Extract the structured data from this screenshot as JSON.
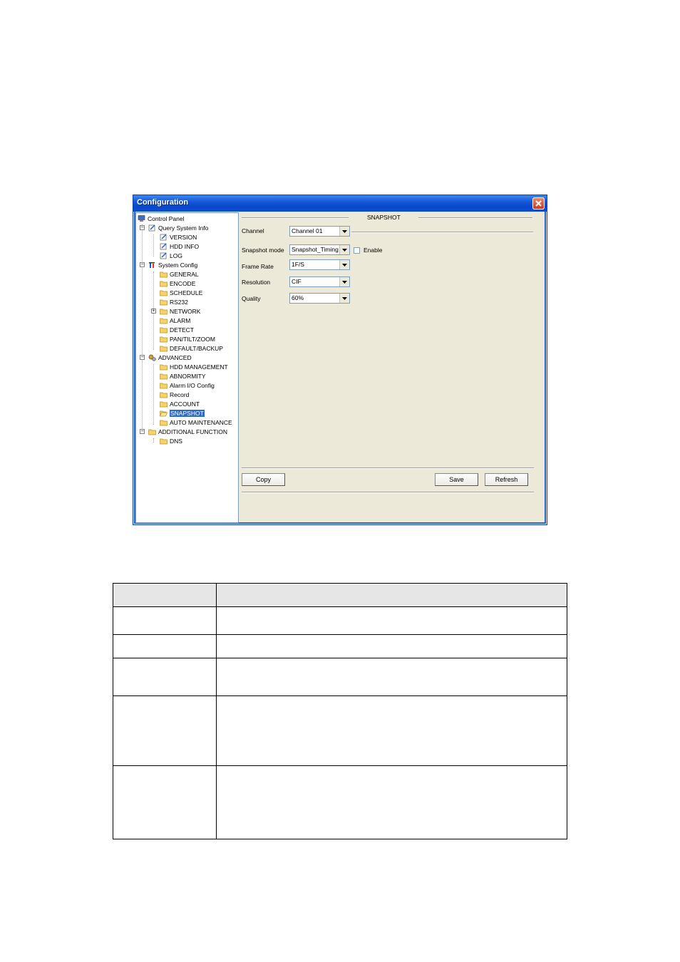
{
  "window": {
    "title": "Configuration"
  },
  "tree": {
    "root": "Control Panel",
    "items": [
      "Query System Info",
      "VERSION",
      "HDD INFO",
      "LOG",
      "System Config",
      "GENERAL",
      "ENCODE",
      "SCHEDULE",
      "RS232",
      "NETWORK",
      "ALARM",
      "DETECT",
      "PAN/TILT/ZOOM",
      "DEFAULT/BACKUP",
      "ADVANCED",
      "HDD MANAGEMENT",
      "ABNORMITY",
      "Alarm I/O Config",
      "Record",
      "ACCOUNT",
      "SNAPSHOT",
      "AUTO MAINTENANCE",
      "ADDITIONAL FUNCTION",
      "DNS"
    ],
    "selected": "SNAPSHOT"
  },
  "panel": {
    "section_title": "SNAPSHOT",
    "channel_label": "Channel",
    "channel_value": "Channel 01",
    "mode_label": "Snapshot mode",
    "mode_value": "Snapshot_Timing",
    "enable_label": "Enable",
    "framerate_label": "Frame Rate",
    "framerate_value": "1F/S",
    "resolution_label": "Resolution",
    "resolution_value": "CIF",
    "quality_label": "Quality",
    "quality_value": "60%"
  },
  "buttons": {
    "copy": "Copy",
    "save": "Save",
    "refresh": "Refresh"
  },
  "colors": {
    "titlebar": "#0a47c9",
    "selection": "#316ac5",
    "panel_bg": "#ece9d8"
  }
}
